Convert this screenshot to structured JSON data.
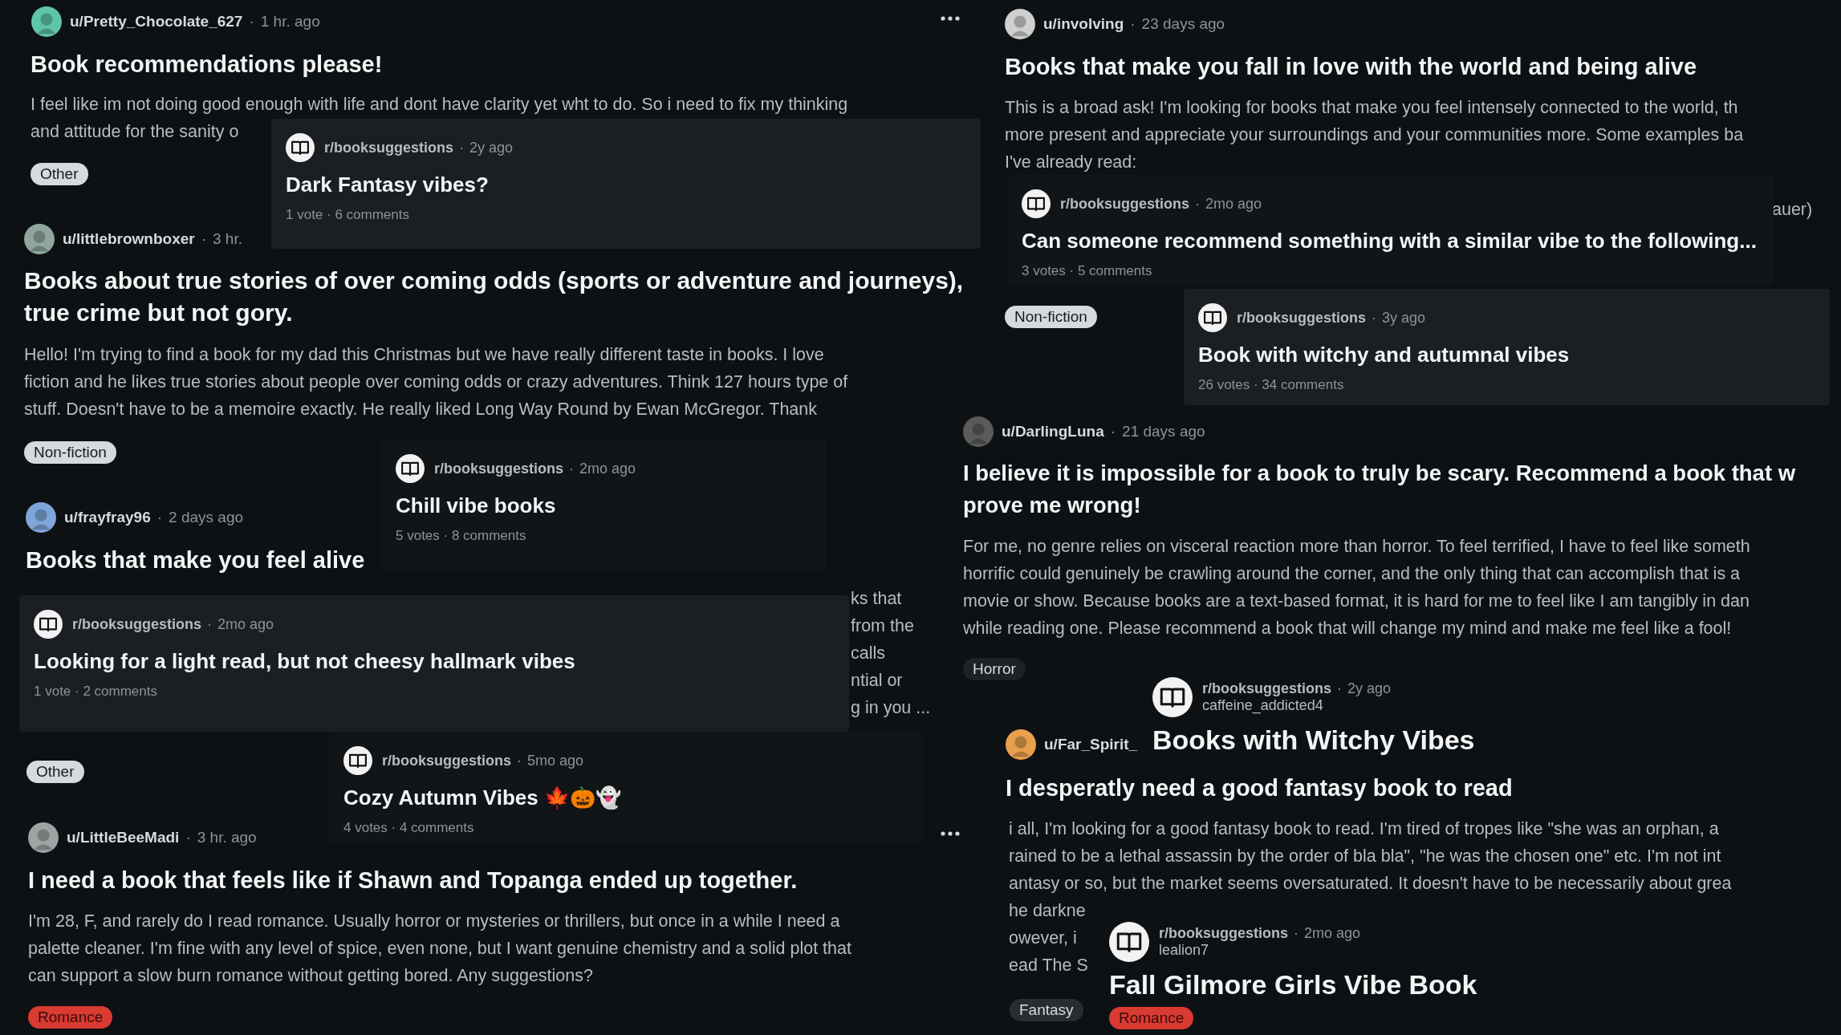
{
  "posts": [
    {
      "author": "u/Pretty_Chocolate_627",
      "dot": "·",
      "age": "1 hr. ago",
      "avatar": {
        "color": "#5ec6a6"
      },
      "has_menu": true,
      "title_lines": [
        "Book recommendations please!"
      ],
      "body_lines": [
        "I feel like im not doing good enough with life and dont have clarity yet wht to do. So i need to fix my thinking",
        "and attitude for the sanity o"
      ],
      "tag": {
        "label": "Other",
        "color": "#d7dadc"
      }
    },
    {
      "author": "u/littlebrownboxer",
      "dot": "·",
      "age": "3 hr.",
      "avatar": {
        "color": "#8fa69c"
      },
      "has_menu": false,
      "title_lines": [
        "Books about true stories of over coming odds (sports or adventure and journeys),",
        "true crime but not gory."
      ],
      "body_lines": [
        "Hello! I'm trying to find a book for my dad this Christmas but we have really different taste in books. I love",
        "fiction and he likes true stories about people over coming odds or crazy adventures. Think 127 hours type of",
        "stuff. Doesn't have to be a memoire exactly. He really liked Long Way Round by Ewan McGregor. Thank"
      ],
      "tag": {
        "label": "Non-fiction",
        "color": "#d7dadc"
      }
    },
    {
      "author": "u/frayfray96",
      "dot": "·",
      "age": "2 days ago",
      "avatar": {
        "color": "#7fa6d8"
      },
      "has_menu": false,
      "title_lines": [
        "Books that make you feel alive"
      ],
      "body_lines": [
        "ks that",
        "from the",
        "calls",
        "ntial or",
        "g in you ..."
      ],
      "tag": {
        "label": "Other",
        "color": "#d7dadc"
      }
    },
    {
      "author": "u/LittleBeeMadi",
      "dot": "·",
      "age": "3 hr. ago",
      "avatar": {
        "color": "#9ea3a3"
      },
      "has_menu": true,
      "title_lines": [
        "I need a book that feels like if Shawn and Topanga ended up together."
      ],
      "body_lines": [
        "I'm 28, F, and rarely do I read romance. Usually horror or mysteries or thrillers, but once in a while I need a",
        "palette cleaner. I'm fine with any level of spice, even none, but I want genuine chemistry and a solid plot that",
        "can support a slow burn romance without getting bored. Any suggestions?"
      ],
      "tag": {
        "label": "Romance",
        "color": "#d93a32"
      }
    },
    {
      "author": "u/involving",
      "dot": "·",
      "age": "23 days ago",
      "avatar": {
        "color": "#cfcfcf"
      },
      "has_menu": false,
      "title_lines": [
        "Books that make you fall in love with the world and being alive"
      ],
      "body_lines": [
        "This is a broad ask! I'm looking for books that make you feel intensely connected to the world, th",
        "more present and appreciate your surroundings and your communities more. Some examples ba",
        "I've already read:"
      ],
      "fragments": [
        "auer)"
      ],
      "tag": {
        "label": "Non-fiction",
        "color": "#d7dadc"
      }
    },
    {
      "author": "u/DarlingLuna",
      "dot": "·",
      "age": "21 days ago",
      "avatar": {
        "color": "#5b5b5b"
      },
      "has_menu": false,
      "title_lines": [
        "I believe it is impossible for a book to truly be scary. Recommend a book that w",
        "prove me wrong!"
      ],
      "body_lines": [
        "For me, no genre relies on visceral reaction more than horror. To feel terrified, I have to feel like someth",
        "horrific could genuinely be crawling around the corner, and the only thing that can accomplish that is a",
        "movie or show. Because books are a text-based format, it is hard for me to feel like I am tangibly in dan",
        "while reading one. Please recommend a book that will change my mind and make me feel like a fool!"
      ],
      "tag": {
        "label": "Horror",
        "color": "#1f2225"
      }
    },
    {
      "author": "u/Far_Spirit_",
      "avatar": {
        "color": "#e9a04c"
      },
      "has_menu": false,
      "title_lines": [
        "I desperatly need a good fantasy book to read"
      ],
      "body_lines": [
        "i all, I'm looking for a good fantasy book to read. I'm tired of tropes like \"she was an orphan, a",
        "rained to be a lethal assassin by the order of bla bla\", \"he was the chosen one\" etc. I'm not int",
        "antasy or so, but the market seems oversaturated. It doesn't have to be necessarily about grea",
        "he darkne",
        "owever, i",
        "ead The S"
      ],
      "tag": {
        "label": "Fantasy",
        "color": "#2a2d30"
      }
    }
  ],
  "cards": [
    {
      "kind": "raised",
      "subreddit": "r/booksuggestions",
      "dot": "·",
      "age": "2y ago",
      "title": "Dark Fantasy vibes?",
      "stats": "1 vote · 6 comments"
    },
    {
      "kind": "dim",
      "subreddit": "r/booksuggestions",
      "dot": "·",
      "age": "2mo ago",
      "title": "Chill vibe books",
      "stats": "5 votes · 8 comments"
    },
    {
      "kind": "raised",
      "subreddit": "r/booksuggestions",
      "dot": "·",
      "age": "2mo ago",
      "title": "Looking for a light read, but not cheesy hallmark vibes",
      "stats": "1 vote · 2 comments"
    },
    {
      "kind": "dim",
      "subreddit": "r/booksuggestions",
      "dot": "·",
      "age": "5mo ago",
      "title": "Cozy Autumn Vibes 🍁🎃👻",
      "stats": "4 votes · 4 comments"
    },
    {
      "kind": "dim",
      "subreddit": "r/booksuggestions",
      "dot": "·",
      "age": "2mo ago",
      "title": "Can someone recommend something with a similar vibe to the following...",
      "stats": "3 votes · 5 comments"
    },
    {
      "kind": "raised",
      "subreddit": "r/booksuggestions",
      "dot": "·",
      "age": "3y ago",
      "title": "Book with witchy and autumnal vibes",
      "stats": "26 votes · 34 comments"
    },
    {
      "kind": "flat",
      "subreddit": "r/booksuggestions",
      "dot": "·",
      "age": "2y ago",
      "poster": "caffeine_addicted4",
      "title": "Books with Witchy Vibes"
    },
    {
      "kind": "flat",
      "subreddit": "r/booksuggestions",
      "dot": "·",
      "age": "2mo ago",
      "poster": "lealion7",
      "title": "Fall Gilmore Girls Vibe Book",
      "tag": {
        "label": "Romance",
        "color": "#d93a32"
      }
    }
  ]
}
